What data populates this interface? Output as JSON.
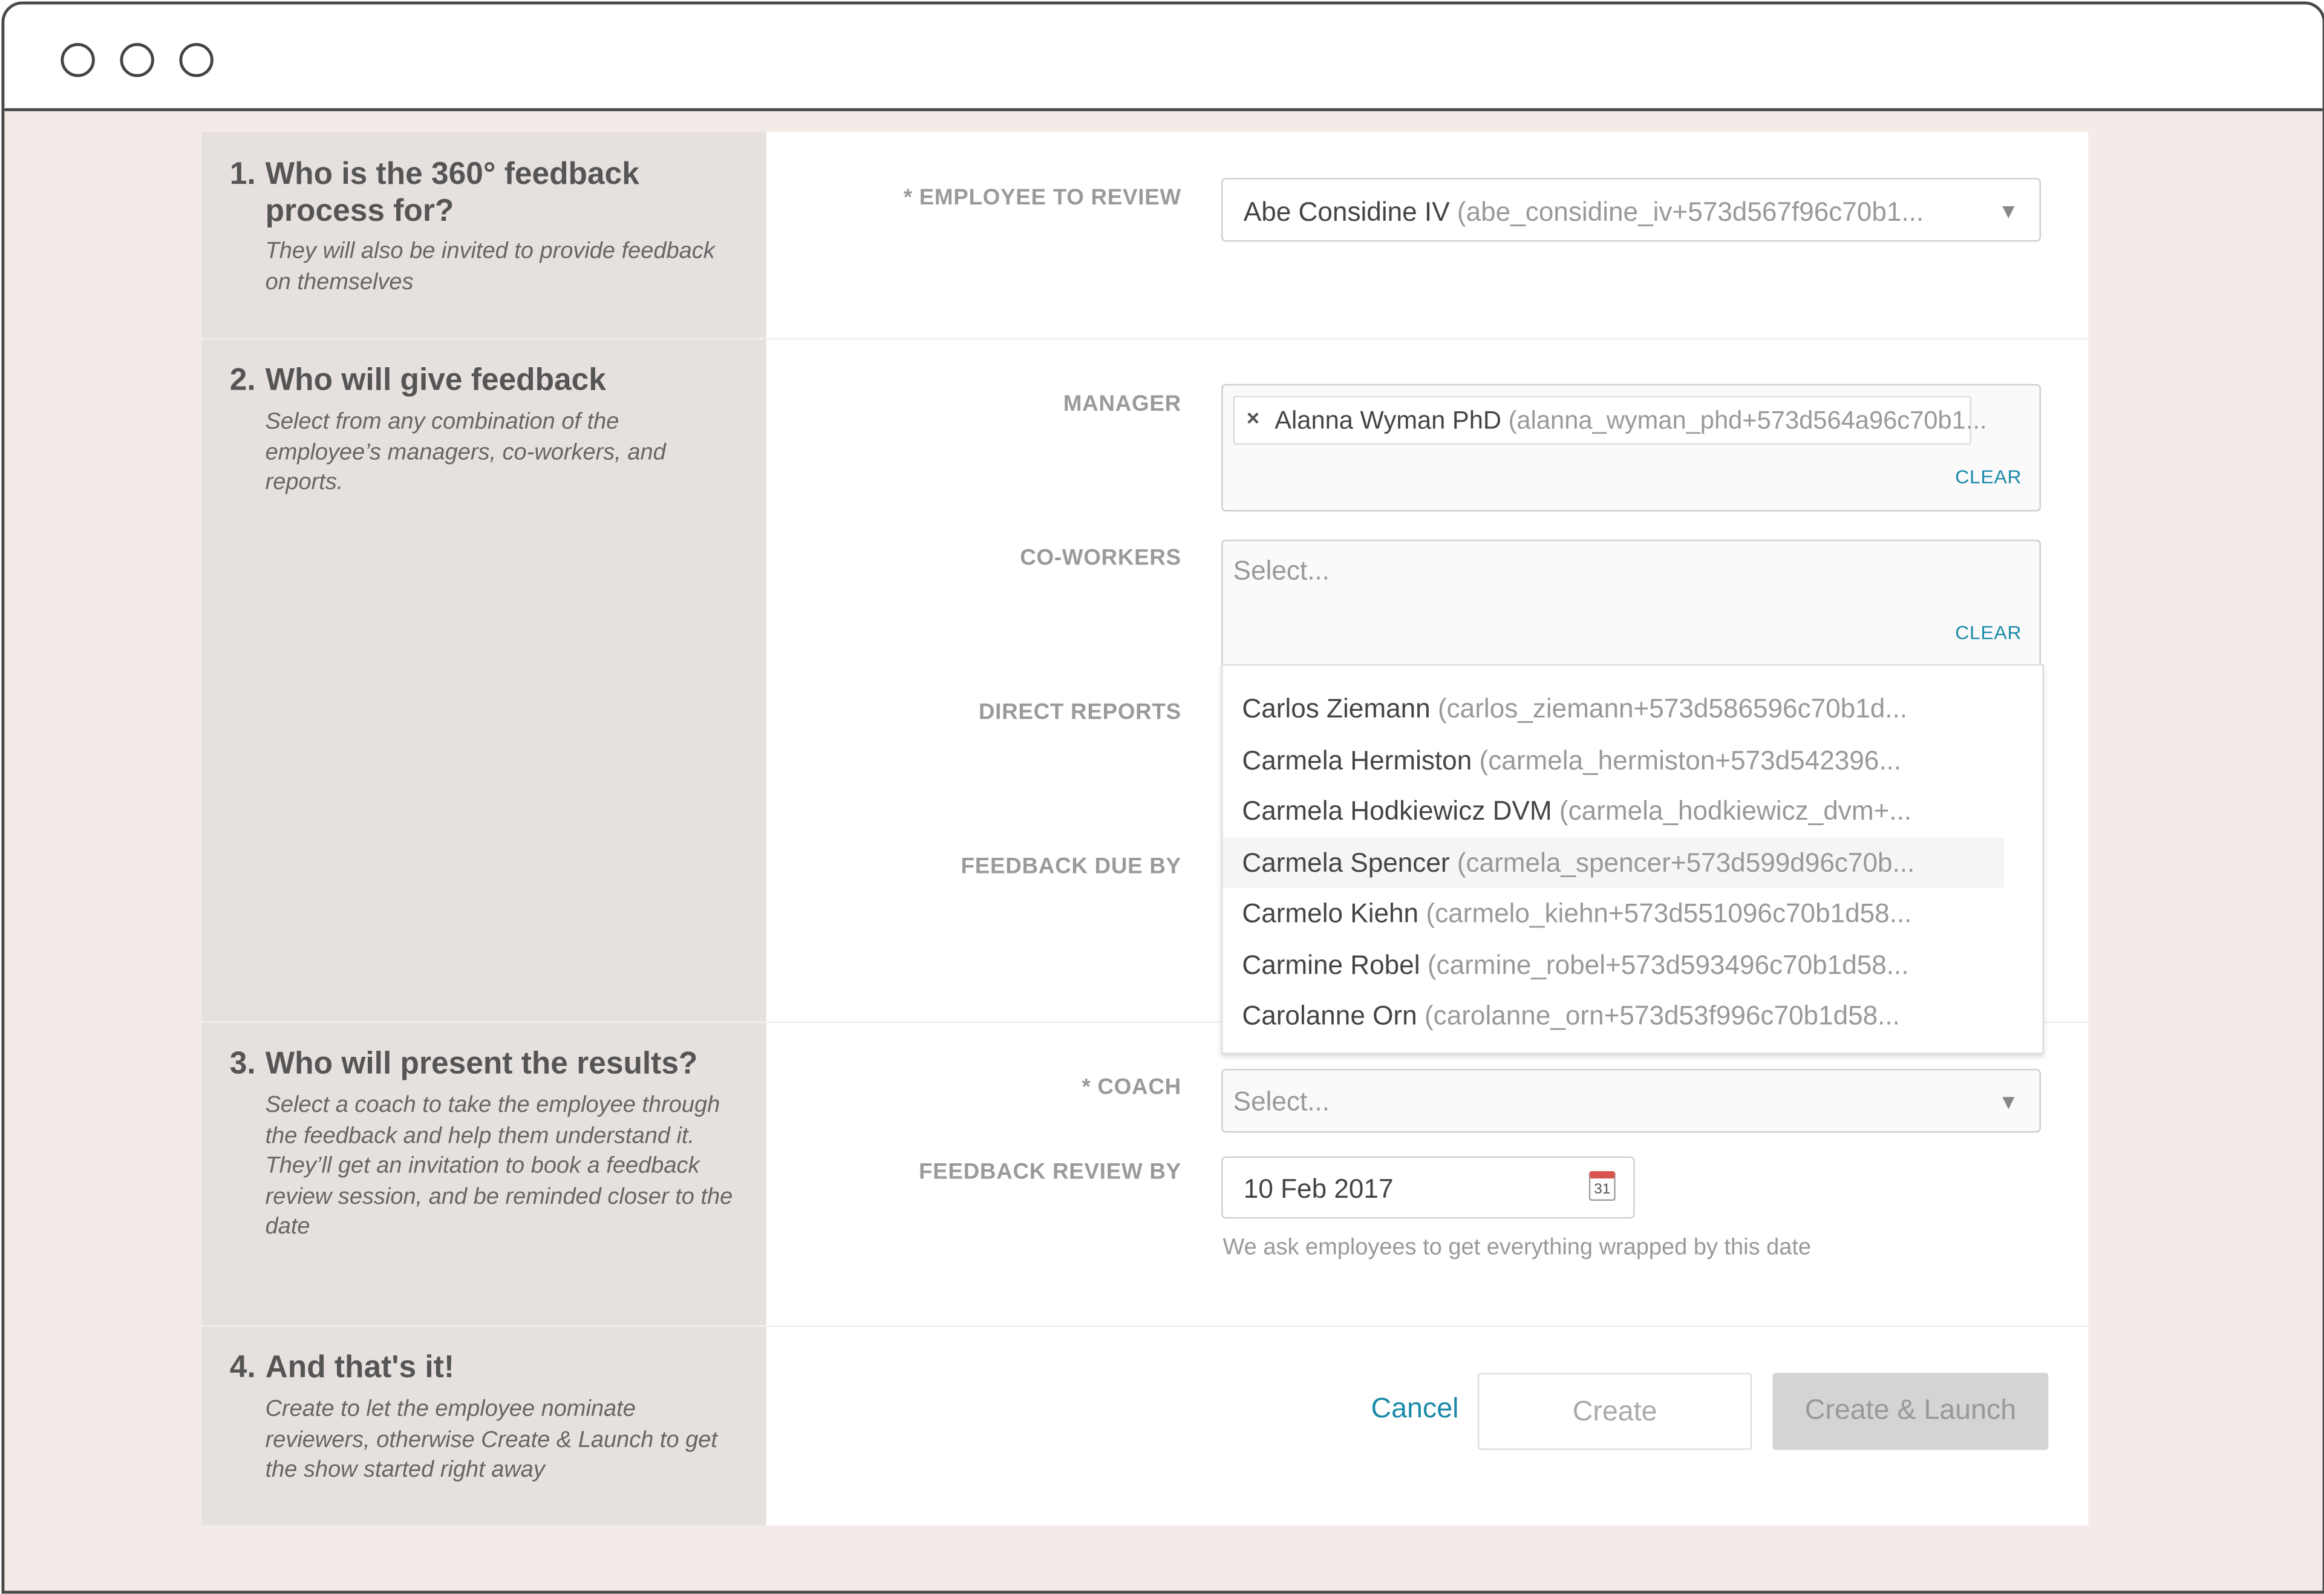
{
  "window": {
    "controls": [
      "close",
      "minimize",
      "maximize"
    ]
  },
  "sections": [
    {
      "number": "1.",
      "title": "Who is the 360° feedback process for?",
      "description": "They will also be invited to provide feedback on themselves"
    },
    {
      "number": "2.",
      "title": "Who will give feedback",
      "description": "Select from any combination of the employee’s managers, co-workers, and reports."
    },
    {
      "number": "3.",
      "title": "Who will present the results?",
      "description": "Select a coach to take the employee through the feedback and help them understand it. They’ll get an invitation to book a feedback review session, and be reminded closer to the date"
    },
    {
      "number": "4.",
      "title": "And that's it!",
      "description": "Create to let the employee nominate reviewers, otherwise Create & Launch to get the show started right away"
    }
  ],
  "fields": {
    "employee": {
      "label": "* EMPLOYEE TO REVIEW",
      "name": "Abe Considine IV",
      "email": "(abe_considine_iv+573d567f96c70b1..."
    },
    "manager": {
      "label": "MANAGER",
      "tag_name": "Alanna Wyman PhD",
      "tag_email": "(alanna_wyman_phd+573d564a96c70b1...",
      "clear": "CLEAR"
    },
    "coworkers": {
      "label": "CO-WORKERS",
      "placeholder": "Select...",
      "clear": "CLEAR"
    },
    "direct_reports": {
      "label": "DIRECT REPORTS"
    },
    "feedback_due": {
      "label": "FEEDBACK DUE BY"
    },
    "coach": {
      "label": "* COACH",
      "placeholder": "Select..."
    },
    "review_by": {
      "label": "FEEDBACK REVIEW BY",
      "value": "10 Feb 2017",
      "help": "We ask employees to get everything wrapped by this date"
    }
  },
  "dropdown": {
    "items": [
      {
        "name": "Carlos Ziemann",
        "email": "(carlos_ziemann+573d586596c70b1d..."
      },
      {
        "name": "Carmela Hermiston",
        "email": "(carmela_hermiston+573d542396..."
      },
      {
        "name": "Carmela Hodkiewicz DVM",
        "email": "(carmela_hodkiewicz_dvm+..."
      },
      {
        "name": "Carmela Spencer",
        "email": "(carmela_spencer+573d599d96c70b...",
        "highlighted": true
      },
      {
        "name": "Carmelo Kiehn",
        "email": "(carmelo_kiehn+573d551096c70b1d58..."
      },
      {
        "name": "Carmine Robel",
        "email": "(carmine_robel+573d593496c70b1d58..."
      },
      {
        "name": "Carolanne Orn",
        "email": "(carolanne_orn+573d53f996c70b1d58..."
      }
    ]
  },
  "actions": {
    "cancel": "Cancel",
    "create": "Create",
    "create_launch": "Create & Launch"
  },
  "colors": {
    "accent": "#1a8aa8",
    "background": "#f3ebe8",
    "left_panel": "#e6e1de"
  },
  "icons": {
    "calendar": "calendar-icon",
    "caret": "caret-down-icon",
    "remove": "close-icon"
  }
}
